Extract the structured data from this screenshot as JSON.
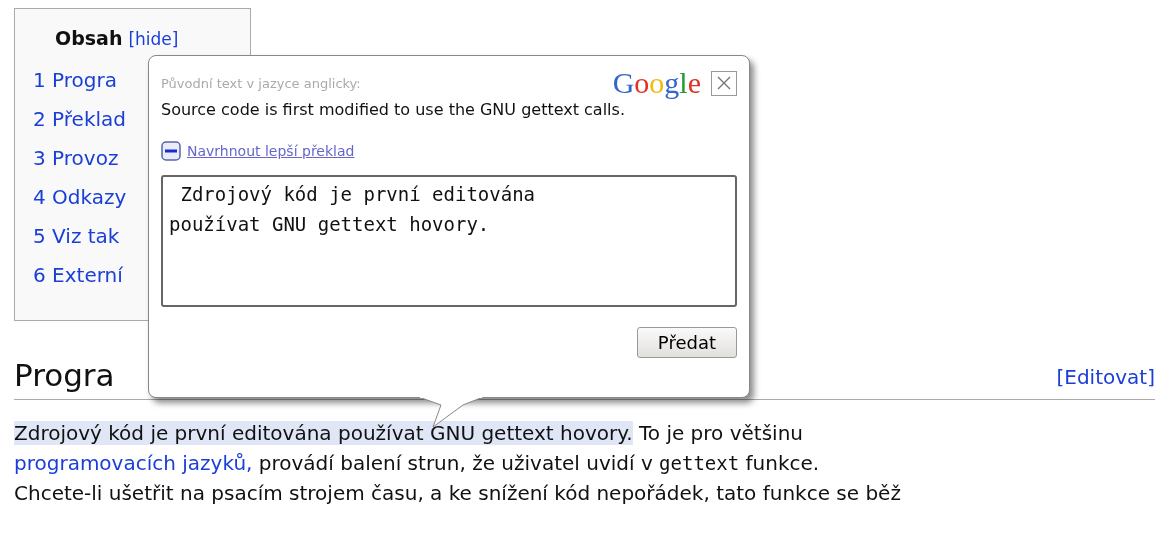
{
  "toc": {
    "title": "Obsah",
    "toggle": "[hide]",
    "items": [
      {
        "label": "1 Progra"
      },
      {
        "label": "2 Překlad"
      },
      {
        "label": "3 Provoz"
      },
      {
        "label": "4 Odkazy"
      },
      {
        "label": "5 Viz tak"
      },
      {
        "label": "6 Externí"
      }
    ]
  },
  "heading": {
    "title": "Progra",
    "edit_link": "[Editovat]"
  },
  "paragraph": {
    "lines": [
      [
        {
          "kind": "highlight",
          "text": "Zdrojový kód je první editována používat GNU gettext hovory."
        },
        {
          "kind": "text",
          "text": " To je pro většinu"
        }
      ],
      [
        {
          "kind": "link",
          "text": "programovacích jazyků,"
        },
        {
          "kind": "text",
          "text": " provádí balení strun, že uživatel uvidí v "
        },
        {
          "kind": "code",
          "text": "gettext"
        },
        {
          "kind": "text",
          "text": " funkce."
        }
      ],
      [
        {
          "kind": "text",
          "text": "Chcete-li ušetřit na psacím strojem času, a ke snížení kód nepořádek, tato funkce se běž"
        }
      ]
    ]
  },
  "translate_popup": {
    "source_label": "Původní text v jazyce anglicky:",
    "logo": "Google",
    "source_text": "Source code is first modified to use the GNU gettext calls.",
    "suggest_link": "Navrhnout lepší překlad",
    "suggestion_value": " Zdrojový kód je první editována\npoužívat GNU gettext hovory.",
    "submit_button": "Předat"
  }
}
